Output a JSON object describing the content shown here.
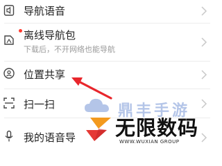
{
  "menu": {
    "items": [
      {
        "label": "导航语音",
        "icon": "speaker-icon"
      },
      {
        "label": "离线导航包",
        "sublabel": "下载后，不开网络也能导航",
        "icon": "offline-map-icon",
        "badge": "red-dot"
      },
      {
        "label": "位置共享",
        "icon": "location-share-icon"
      },
      {
        "label": "扫一扫",
        "icon": "scan-icon"
      },
      {
        "label": "我的语音导",
        "icon": "microphone-icon"
      }
    ]
  },
  "watermark": {
    "faint_text": "鼎丰手游",
    "main_text": "无限数码",
    "sub_text": "WWW.WUXIAN GROUP"
  },
  "colors": {
    "text": "#222222",
    "subtext": "#9a9a9a",
    "divider": "#ececec",
    "badge": "#ff3b30",
    "annotation_arrow": "#e8262c",
    "logo_orange": "#f39a1e",
    "logo_red": "#e53935"
  }
}
